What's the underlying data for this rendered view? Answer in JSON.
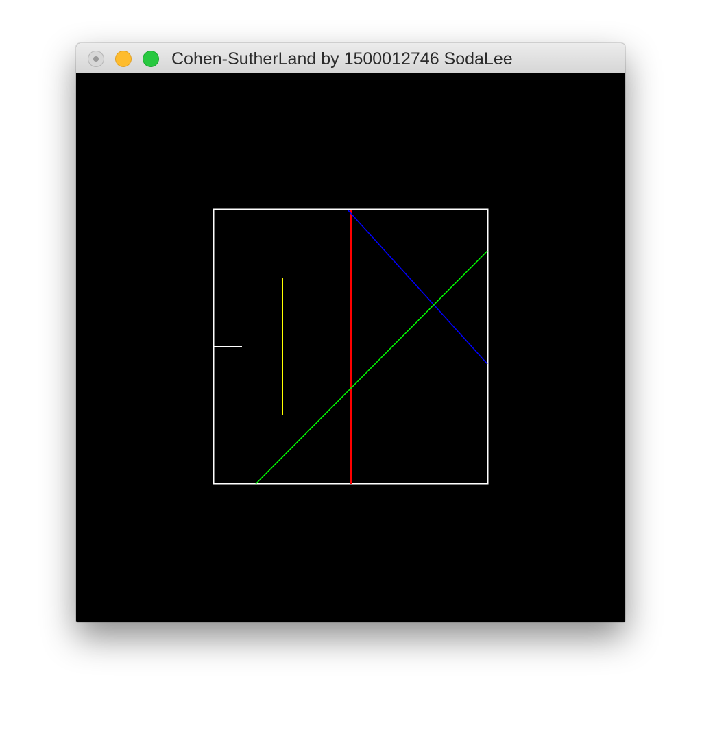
{
  "window": {
    "title": "Cohen-SutherLand by 1500012746 SodaLee"
  },
  "controls": {
    "close_icon": "close-icon",
    "minimize_icon": "minimize-icon",
    "zoom_icon": "zoom-icon"
  },
  "colors": {
    "canvas_bg": "#000000",
    "clip_window": "#ffffff",
    "white_line": "#ffffff",
    "yellow_line": "#ffff00",
    "red_line": "#ff0000",
    "blue_line": "#0000ff",
    "green_line": "#00ff00"
  }
}
